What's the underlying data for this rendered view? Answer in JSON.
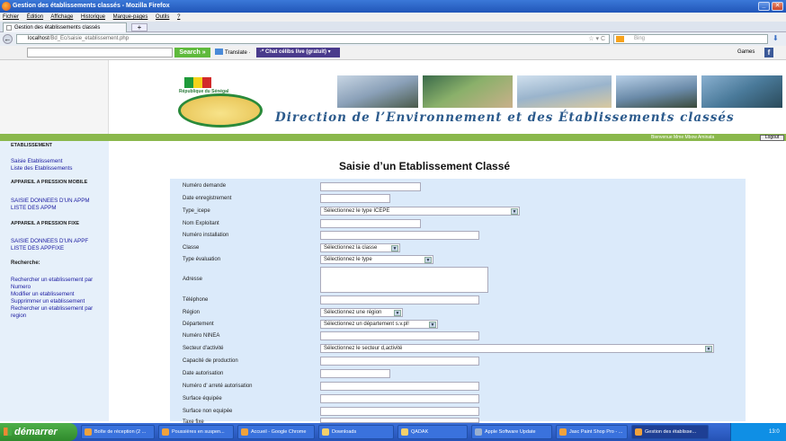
{
  "window": {
    "title": "Gestion des établissements classés - Mozilla Firefox",
    "min": "_",
    "max": "□"
  },
  "menubar": [
    "Fichier",
    "Édition",
    "Affichage",
    "Historique",
    "Marque-pages",
    "Outils",
    "?"
  ],
  "tab": {
    "label": "Gestion des établissements classés",
    "new": "+"
  },
  "nav": {
    "back": "←",
    "url_host": "localhost",
    "url_path": "/Bd_Ec/saisie_etablissement.php",
    "url_icons": "☆ ▾ C",
    "search_engine": "Bing"
  },
  "toolbar": {
    "search_button": "Search »",
    "translate": "Translate ·",
    "chat": "·* Chat célibs live (gratuit) ▾",
    "games": "Games",
    "fb": "f"
  },
  "banner": {
    "republic": "République du Sénégal",
    "title": "Direction de l’Environnement et des Établissements classés",
    "flag_colors": [
      "#1e9a3a",
      "#f5d31a",
      "#d22a2a"
    ]
  },
  "userbar": {
    "welcome": "Bienvenue Mme Mbow Aminata",
    "logout": "Logout"
  },
  "sidebar": {
    "sections": [
      {
        "title": "ETABLISSEMENT",
        "links": [
          "Saisie Etablissement",
          "Liste des Etablissements"
        ]
      },
      {
        "title": "APPAREIL A PRESSION MOBILE",
        "links": [
          "SAISIE DONNEES D'UN APPM",
          "LISTE DES APPM"
        ]
      },
      {
        "title": "APPAREIL A PRESSION FIXE",
        "links": [
          "SAISIE DONNEES D'UN APPF",
          "LISTE DES APPFIXE"
        ]
      },
      {
        "title": "Recherche:",
        "links": [
          "Rechercher un etablissement par",
          "Numero",
          "Modifier un etablissement",
          "Supprimmer un etablissement",
          "Rechercher un etablissement par",
          "region"
        ]
      }
    ]
  },
  "form": {
    "title": "Saisie d’un Etablissement Classé",
    "fields": [
      {
        "label": "Numéro demande"
      },
      {
        "label": "Date enregistrement"
      },
      {
        "label": "Type_icepe",
        "select": "Sélectionnez le type ICEPE"
      },
      {
        "label": "Nom Exploitant"
      },
      {
        "label": "Numéro installation"
      },
      {
        "label": "Classe",
        "select": "Sélectionnez la classe"
      },
      {
        "label": "Type évaluation",
        "select": "Sélectionnez le type"
      },
      {
        "label": "Adresse"
      },
      {
        "label": "Téléphone"
      },
      {
        "label": "Région",
        "select": "Sélectionnez une région"
      },
      {
        "label": "Département",
        "select": "Sélectionnez un département s.v.pl!"
      },
      {
        "label": "Numéro NINEA"
      },
      {
        "label": "Secteur d'activité",
        "select": "Sélectionnez le secteur d,activité"
      },
      {
        "label": "Capacité de production"
      },
      {
        "label": "Date autorisation"
      },
      {
        "label": "Numéro d' arreté autorisation"
      },
      {
        "label": "Surface équipée"
      },
      {
        "label": "Surface non equipée"
      },
      {
        "label": "Taxe fixe"
      }
    ]
  },
  "taskbar": {
    "start": "démarrer",
    "tasks": [
      "Boîte de réception (2 ...",
      "Poussières en suspen...",
      "Accueil - Google Chrome",
      "Downloads",
      "QADAK",
      "Apple Software Update",
      "Jasc Paint Shop Pro - ...",
      "Gestion des établisse..."
    ],
    "clock": "13:0"
  }
}
